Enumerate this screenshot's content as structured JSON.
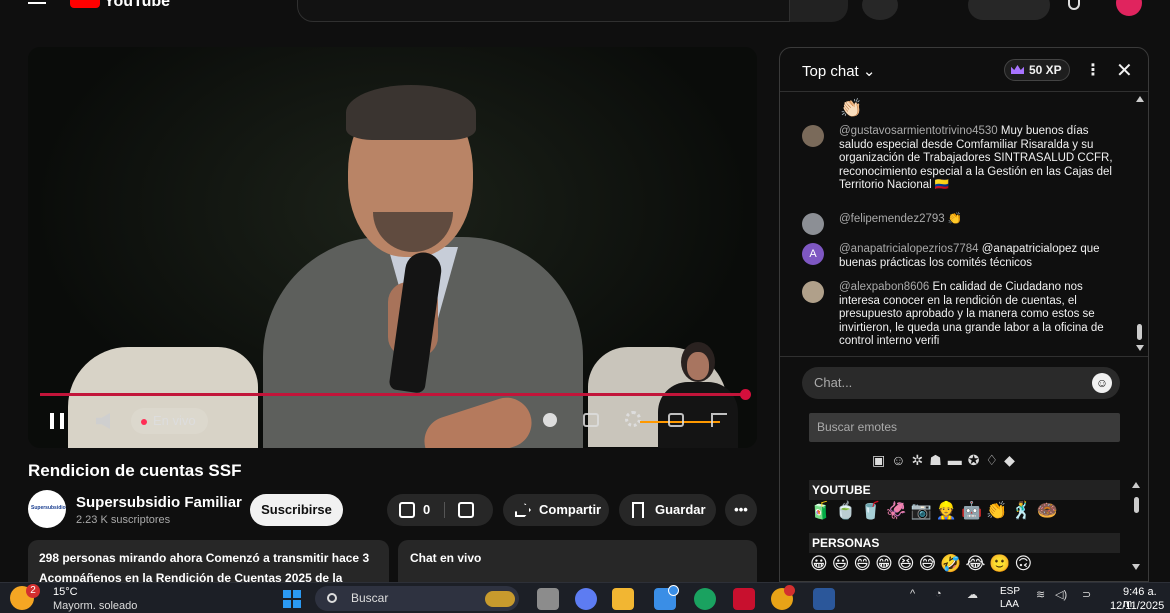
{
  "header": {
    "logo_text": "YouTube"
  },
  "player": {
    "live_label": "En vivo",
    "progress_fraction": 0.98
  },
  "video": {
    "title": "Rendicion de cuentas SSF",
    "channel_name": "Supersubsidio Familiar",
    "channel_avatar_text": "Supersubsidio",
    "subscribers": "2.23 K suscriptores",
    "subscribe_label": "Suscribirse",
    "like_count": "0",
    "share_label": "Compartir",
    "save_label": "Guardar",
    "more_label": "•••",
    "description_line1": "298 personas mirando ahora  Comenzó a transmitir hace 3",
    "description_line2": "Acompáñenos en la Rendición de Cuentas 2025 de la",
    "chat_live_label": "Chat en vivo"
  },
  "chat": {
    "title": "Top chat",
    "xp_label": "50 XP",
    "top_emojis": "👏🏻",
    "messages": [
      {
        "author": "@gustavosarmientotrivino4530",
        "text": "Muy buenos días saludo especial desde Comfamiliar Risaralda y su organización de Trabajadores SINTRASALUD CCFR, reconocimiento especial a la Gestión en las Cajas del Territorio Nacional 🇨🇴"
      },
      {
        "author": "@felipemendez2793",
        "text": "👏"
      },
      {
        "author": "@anapatricialopezrios7784",
        "text": "@anapatricialopez que buenas prácticas los comités técnicos"
      },
      {
        "author": "@alexpabon8606",
        "text": "En calidad de Ciudadano nos interesa conocer en la rendición de cuentas, el presupuesto aprobado y la manera como estos se invirtieron, le queda una grande labor a la oficina de control interno verifi"
      }
    ],
    "avatar_letters": [
      "",
      "",
      "A",
      ""
    ],
    "input_placeholder": "Chat...",
    "emote_search_placeholder": "Buscar emotes",
    "emote_sections": [
      "YOUTUBE",
      "PERSONAS"
    ],
    "youtube_emotes": "🧃🍵🥤🦑📷👷🤖👏🕺🍩",
    "people_emotes": "😀😃😄😁😆😅🤣😂🙂🙃"
  },
  "taskbar": {
    "weather_badge": "2",
    "temperature": "15°C",
    "weather": "Mayorm. soleado",
    "search_placeholder": "Buscar",
    "lang_line1": "ESP",
    "lang_line2": "LAA",
    "time": "9:46 a. m.",
    "date": "12/11/2025"
  },
  "colors": {
    "accent": "#ff0000",
    "progress": "#c2153a",
    "subscribe_bg": "#f1f1f1"
  }
}
